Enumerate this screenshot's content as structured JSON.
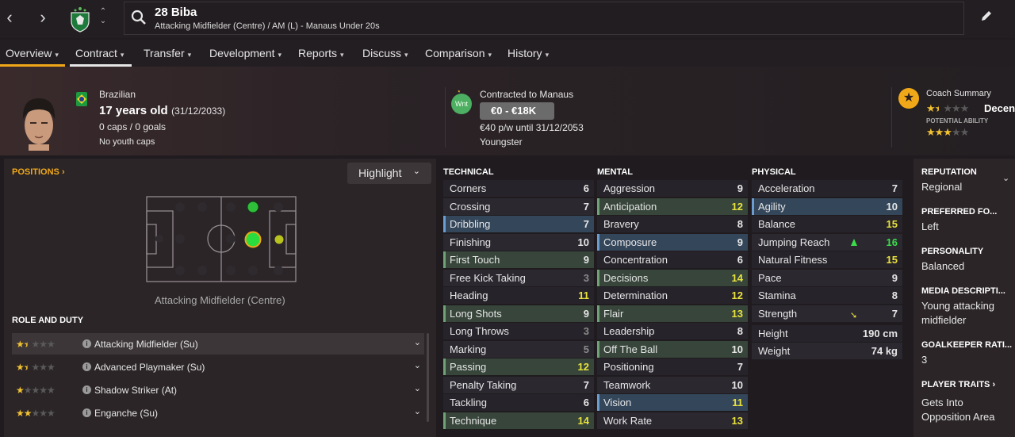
{
  "player": {
    "number_name": "28 Biba",
    "subtitle": "Attacking Midfielder (Centre) / AM (L) - Manaus Under 20s"
  },
  "tabs": [
    {
      "label": "Overview"
    },
    {
      "label": "Contract"
    },
    {
      "label": "Transfer"
    },
    {
      "label": "Development"
    },
    {
      "label": "Reports"
    },
    {
      "label": "Discuss"
    },
    {
      "label": "Comparison"
    },
    {
      "label": "History"
    }
  ],
  "header": {
    "nationality": "Brazilian",
    "age": "17 years old",
    "dob": "(31/12/2033)",
    "caps": "0 caps / 0 goals",
    "youth_caps": "No youth caps",
    "contract_label": "Contracted to Manaus",
    "status_badge": "Wnt",
    "value": "€0 - €18K",
    "wage": "€40 p/w until 31/12/2053",
    "contract_type": "Youngster",
    "coach_summary_label": "Coach Summary",
    "coach_summary_value": "Decent",
    "potential_label": "POTENTIAL ABILITY",
    "current_stars": 1.5,
    "potential_stars": 3
  },
  "positions": {
    "link": "POSITIONS",
    "highlight": "Highlight",
    "caption": "Attacking Midfielder (Centre)"
  },
  "roles": {
    "heading": "ROLE AND DUTY",
    "items": [
      {
        "name": "Attacking Midfielder (Su)",
        "stars": 1.5
      },
      {
        "name": "Advanced Playmaker (Su)",
        "stars": 1.5
      },
      {
        "name": "Shadow Striker (At)",
        "stars": 1
      },
      {
        "name": "Enganche (Su)",
        "stars": 2
      }
    ]
  },
  "technical": {
    "heading": "TECHNICAL",
    "items": [
      {
        "name": "Corners",
        "value": "6"
      },
      {
        "name": "Crossing",
        "value": "7"
      },
      {
        "name": "Dribbling",
        "value": "7"
      },
      {
        "name": "Finishing",
        "value": "10"
      },
      {
        "name": "First Touch",
        "value": "9"
      },
      {
        "name": "Free Kick Taking",
        "value": "3"
      },
      {
        "name": "Heading",
        "value": "11"
      },
      {
        "name": "Long Shots",
        "value": "9"
      },
      {
        "name": "Long Throws",
        "value": "3"
      },
      {
        "name": "Marking",
        "value": "5"
      },
      {
        "name": "Passing",
        "value": "12"
      },
      {
        "name": "Penalty Taking",
        "value": "7"
      },
      {
        "name": "Tackling",
        "value": "6"
      },
      {
        "name": "Technique",
        "value": "14"
      }
    ]
  },
  "mental": {
    "heading": "MENTAL",
    "items": [
      {
        "name": "Aggression",
        "value": "9"
      },
      {
        "name": "Anticipation",
        "value": "12"
      },
      {
        "name": "Bravery",
        "value": "8"
      },
      {
        "name": "Composure",
        "value": "9"
      },
      {
        "name": "Concentration",
        "value": "6"
      },
      {
        "name": "Decisions",
        "value": "14"
      },
      {
        "name": "Determination",
        "value": "12"
      },
      {
        "name": "Flair",
        "value": "13"
      },
      {
        "name": "Leadership",
        "value": "8"
      },
      {
        "name": "Off The Ball",
        "value": "10"
      },
      {
        "name": "Positioning",
        "value": "7"
      },
      {
        "name": "Teamwork",
        "value": "10"
      },
      {
        "name": "Vision",
        "value": "11"
      },
      {
        "name": "Work Rate",
        "value": "13"
      }
    ]
  },
  "physical": {
    "heading": "PHYSICAL",
    "items": [
      {
        "name": "Acceleration",
        "value": "7"
      },
      {
        "name": "Agility",
        "value": "10"
      },
      {
        "name": "Balance",
        "value": "15"
      },
      {
        "name": "Jumping Reach",
        "value": "16"
      },
      {
        "name": "Natural Fitness",
        "value": "15"
      },
      {
        "name": "Pace",
        "value": "9"
      },
      {
        "name": "Stamina",
        "value": "8"
      },
      {
        "name": "Strength",
        "value": "7"
      }
    ],
    "height_label": "Height",
    "height": "190 cm",
    "weight_label": "Weight",
    "weight": "74 kg"
  },
  "sidebar": {
    "reputation_h": "REPUTATION",
    "reputation": "Regional",
    "foot_h": "PREFERRED FO...",
    "foot": "Left",
    "personality_h": "PERSONALITY",
    "personality": "Balanced",
    "media_h": "MEDIA DESCRIPTI...",
    "media": "Young attacking midfielder",
    "gk_h": "GOALKEEPER RATI...",
    "gk": "3",
    "traits_h": "PLAYER TRAITS",
    "traits": "Gets Into Opposition Area"
  },
  "colors": {
    "accent": "#f0a818",
    "positive": "#3bde4a",
    "highlight_value": "#e8e23c"
  }
}
